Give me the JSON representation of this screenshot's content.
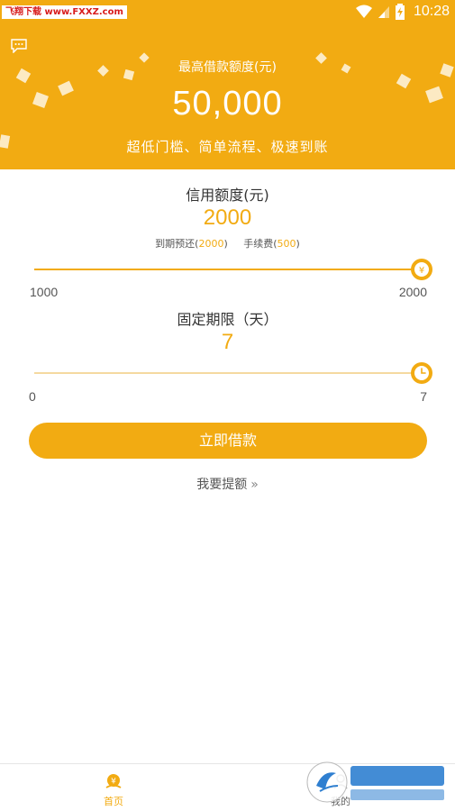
{
  "status_bar": {
    "watermark": "飞翔下载 www.FXXZ.com",
    "time": "10:28"
  },
  "header": {
    "label": "最高借款额度(元)",
    "amount": "50,000",
    "slogan": "超低门槛、简单流程、极速到账"
  },
  "credit": {
    "title": "信用额度(元)",
    "value": "2000",
    "repay_prefix": "到期预还(",
    "repay_value": "2000",
    "repay_suffix": ")",
    "fee_prefix": "手续费(",
    "fee_value": "500",
    "fee_suffix": ")",
    "min_label": "1000",
    "max_label": "2000",
    "slider_fraction": 1.0,
    "thumb_icon": "yen-icon"
  },
  "term": {
    "title": "固定期限（天）",
    "value": "7",
    "min_label": "0",
    "max_label": "7",
    "slider_fraction": 1.0,
    "thumb_icon": "clock-icon"
  },
  "actions": {
    "borrow_label": "立即借款",
    "raise_label": "我要提额",
    "raise_chevron": "»"
  },
  "bottom_nav": {
    "home_label": "首页",
    "mine_label": "我的"
  },
  "colors": {
    "accent": "#f2ab12",
    "track_light": "#f5d9a0"
  }
}
